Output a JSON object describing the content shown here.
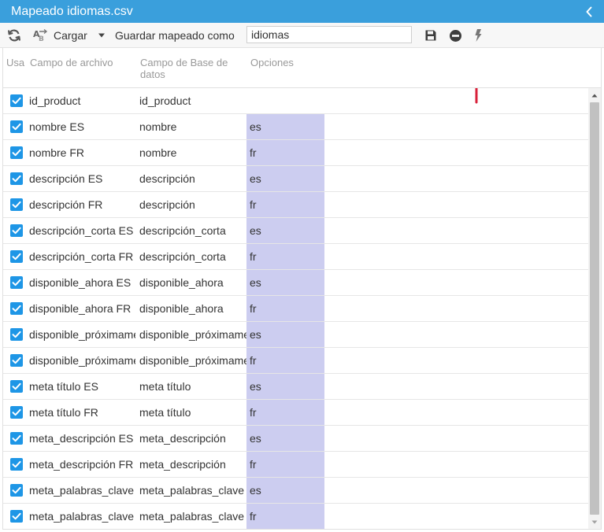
{
  "window": {
    "title": "Mapeado idiomas.csv"
  },
  "toolbar": {
    "load_label": "Cargar",
    "save_as_label": "Guardar mapeado como",
    "mapping_name_value": "idiomas"
  },
  "columns": {
    "use": "Usa",
    "file_field": "Campo de archivo",
    "db_field_line1": "Campo de Base de",
    "db_field_line2": "datos",
    "options": "Opciones"
  },
  "rows": [
    {
      "checked": true,
      "file": "id_product",
      "db": "id_product",
      "opt": ""
    },
    {
      "checked": true,
      "file": "nombre ES",
      "db": "nombre",
      "opt": "es"
    },
    {
      "checked": true,
      "file": "nombre FR",
      "db": "nombre",
      "opt": "fr"
    },
    {
      "checked": true,
      "file": "descripción ES",
      "db": "descripción",
      "opt": "es"
    },
    {
      "checked": true,
      "file": "descripción FR",
      "db": "descripción",
      "opt": "fr"
    },
    {
      "checked": true,
      "file": "descripción_corta ES",
      "db": "descripción_corta",
      "opt": "es"
    },
    {
      "checked": true,
      "file": "descripción_corta FR",
      "db": "descripción_corta",
      "opt": "fr"
    },
    {
      "checked": true,
      "file": "disponible_ahora ES",
      "db": "disponible_ahora",
      "opt": "es"
    },
    {
      "checked": true,
      "file": "disponible_ahora FR",
      "db": "disponible_ahora",
      "opt": "fr"
    },
    {
      "checked": true,
      "file": "disponible_próximame",
      "db": "disponible_próximame",
      "opt": "es"
    },
    {
      "checked": true,
      "file": "disponible_próximame",
      "db": "disponible_próximame",
      "opt": "fr"
    },
    {
      "checked": true,
      "file": "meta título ES",
      "db": "meta título",
      "opt": "es"
    },
    {
      "checked": true,
      "file": "meta título FR",
      "db": "meta título",
      "opt": "fr"
    },
    {
      "checked": true,
      "file": "meta_descripción ES",
      "db": "meta_descripción",
      "opt": "es"
    },
    {
      "checked": true,
      "file": "meta_descripción FR",
      "db": "meta_descripción",
      "opt": "fr"
    },
    {
      "checked": true,
      "file": "meta_palabras_clave",
      "db": "meta_palabras_clave",
      "opt": "es"
    },
    {
      "checked": true,
      "file": "meta_palabras_clave",
      "db": "meta_palabras_clave",
      "opt": "fr"
    }
  ],
  "icons": {
    "refresh": "refresh-icon",
    "load": "load-mapping-icon",
    "dropdown": "caret-down-icon",
    "save": "save-icon",
    "delete": "minus-circle-icon",
    "execute": "lightning-icon",
    "collapse": "chevron-left-icon"
  },
  "colors": {
    "header_blue": "#3a9fdc",
    "checkbox_blue": "#1e96e6",
    "option_fill": "#cccdf0",
    "annotation_arrow": "#d8203a"
  }
}
